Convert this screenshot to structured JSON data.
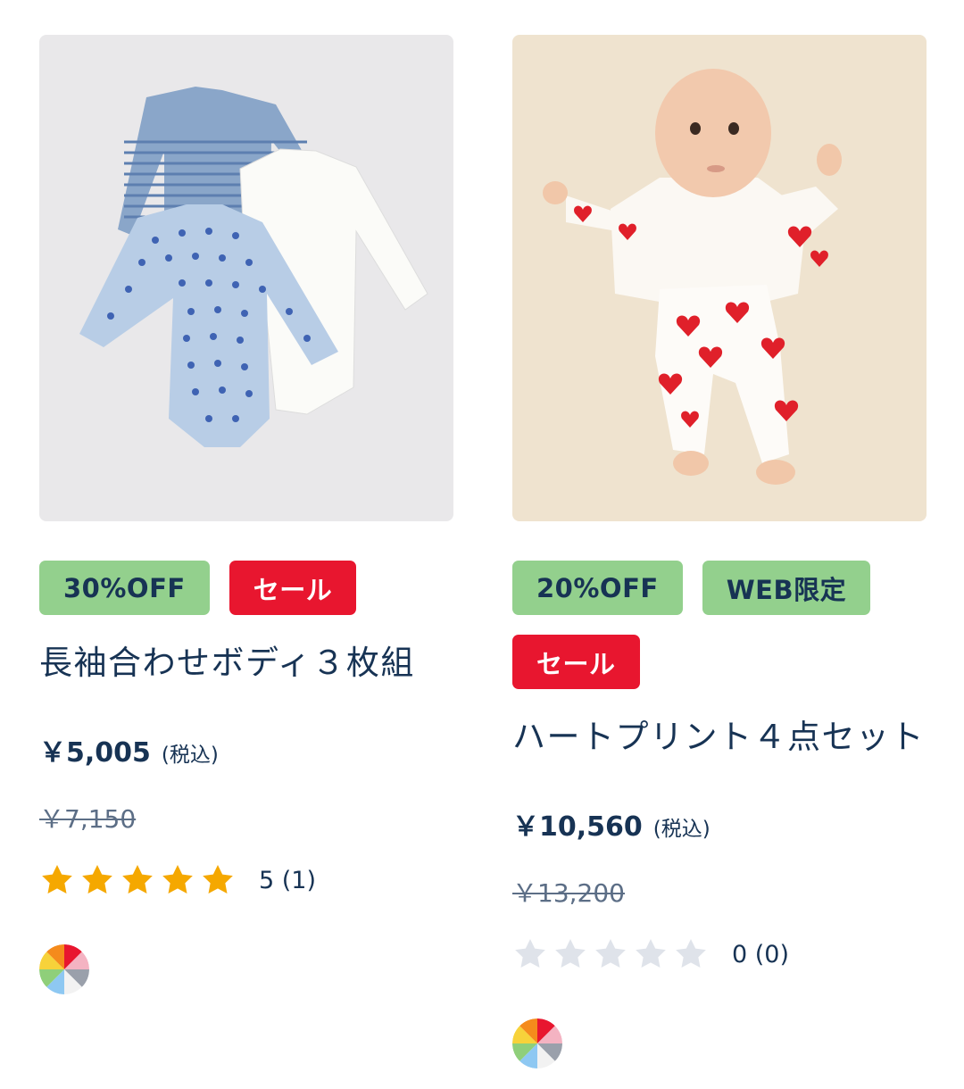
{
  "products": [
    {
      "image_alt": "baby-bodysuits-icon",
      "badges": [
        {
          "label": "30%OFF",
          "style": "green"
        },
        {
          "label": "セール",
          "style": "red"
        }
      ],
      "title": "長袖合わせボディ３枚組",
      "price": "￥5,005",
      "tax_label": "(税込)",
      "original_price": "￥7,150",
      "rating_value": 5,
      "rating_text": "5 (1)",
      "swatch_icon": "multicolor-swatch-icon"
    },
    {
      "image_alt": "baby-heart-print-icon",
      "badges": [
        {
          "label": "20%OFF",
          "style": "green"
        },
        {
          "label": "WEB限定",
          "style": "green"
        },
        {
          "label": "セール",
          "style": "red"
        }
      ],
      "title": "ハートプリント４点セット",
      "price": "￥10,560",
      "tax_label": "(税込)",
      "original_price": "￥13,200",
      "rating_value": 0,
      "rating_text": "0 (0)",
      "swatch_icon": "multicolor-swatch-icon"
    }
  ],
  "colors": {
    "star_filled": "#f5a800",
    "star_empty": "#dfe3ea",
    "badge_green": "#93d08d",
    "badge_red": "#e8162f",
    "text": "#173354"
  }
}
